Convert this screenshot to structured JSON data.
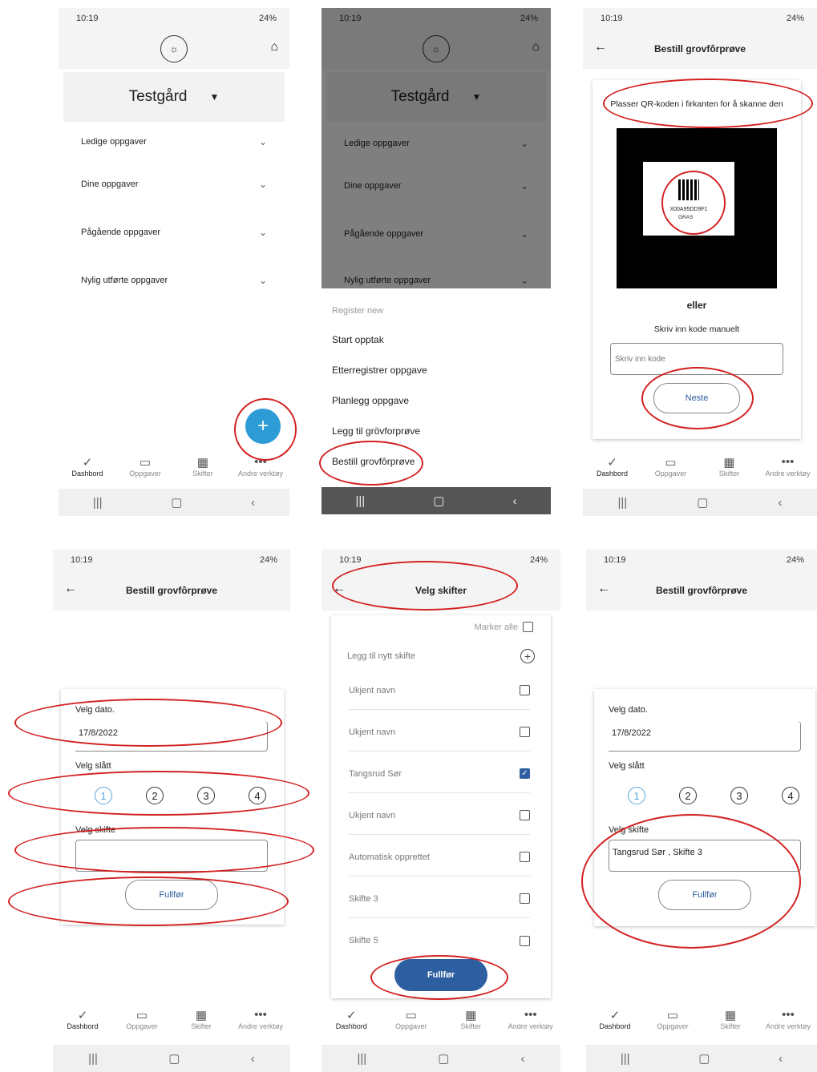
{
  "status": {
    "time": "10:19",
    "battery": "24%"
  },
  "s1": {
    "farm_name": "Testgård",
    "sections": [
      "Ledige oppgaver",
      "Dine oppgaver",
      "Pågående oppgaver",
      "Nylig utførte oppgaver"
    ],
    "fab": "+"
  },
  "s2": {
    "farm_name": "Testgård",
    "sections": [
      "Ledige oppgaver",
      "Dine oppgaver",
      "Pågående oppgaver",
      "Nylig utførte oppgaver"
    ],
    "menu_header": "Register new",
    "menu": [
      "Start opptak",
      "Etterregistrer oppgave",
      "Planlegg oppgave",
      "Legg til grövforprøve",
      "Bestill grovfôrprøve"
    ]
  },
  "s3": {
    "title": "Bestill grovfôrprøve",
    "qr_instruction": "Plasser QR-koden i firkanten for å skanne den",
    "qr_code_text": "X00A95DD9F1",
    "qr_tag": "GRAS",
    "or": "eller",
    "manual_label": "Skriv inn kode manuelt",
    "placeholder": "Skriv inn kode",
    "next": "Neste"
  },
  "s4": {
    "title": "Bestill grovfôrprøve",
    "date_label": "Velg dato.",
    "date_value": "17/8/2022",
    "cut_label": "Velg slått",
    "cuts": [
      "1",
      "2",
      "3",
      "4"
    ],
    "field_label": "Velg skifte",
    "field_value": "",
    "finish": "Fullfør"
  },
  "s5": {
    "title": "Velg skifter",
    "mark_all": "Marker alle",
    "add_field": "Legg til nytt skifte",
    "rows": [
      {
        "name": "Ukjent navn",
        "checked": false
      },
      {
        "name": "Ukjent navn",
        "checked": false
      },
      {
        "name": "Tangsrud Sør",
        "checked": true
      },
      {
        "name": "Ukjent navn",
        "checked": false
      },
      {
        "name": "Automatisk opprettet",
        "checked": false
      },
      {
        "name": "Skifte 3",
        "checked": false
      },
      {
        "name": "Skifte 5",
        "checked": false
      }
    ],
    "finish": "Fullfør"
  },
  "s6": {
    "title": "Bestill grovfôrprøve",
    "date_label": "Velg dato.",
    "date_value": "17/8/2022",
    "cut_label": "Velg slått",
    "cuts": [
      "1",
      "2",
      "3",
      "4"
    ],
    "field_label": "Velg skifte",
    "field_value": "Tangsrud Sør , Skifte 3",
    "finish": "Fullfør"
  },
  "nav": [
    "Dashbord",
    "Oppgaver",
    "Skifter",
    "Andre verktøy"
  ],
  "colors": {
    "accent": "#2d9bd6",
    "highlight": "#d32020",
    "primary_button": "#2d5fa0"
  }
}
